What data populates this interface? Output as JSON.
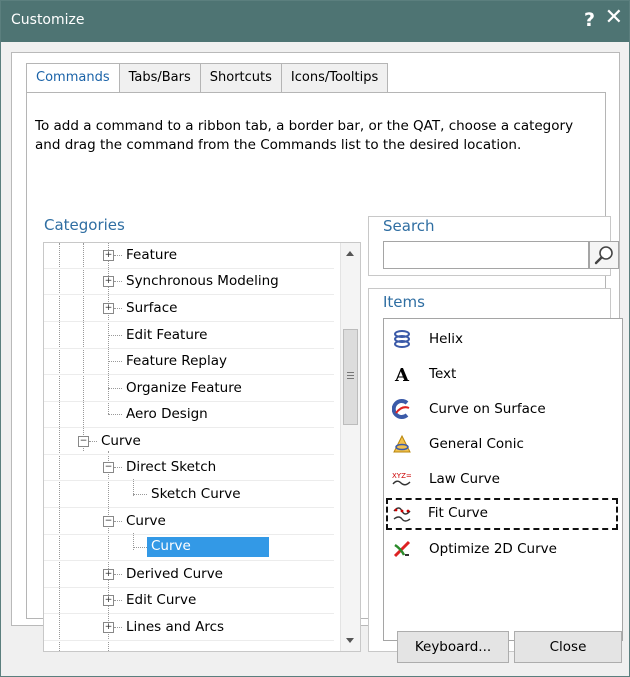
{
  "window": {
    "title": "Customize",
    "help_glyph": "?",
    "close_glyph": "✕"
  },
  "tabs": [
    {
      "label": "Commands",
      "active": true
    },
    {
      "label": "Tabs/Bars"
    },
    {
      "label": "Shortcuts"
    },
    {
      "label": "Icons/Tooltips"
    }
  ],
  "instructions": "To add a command to a ribbon tab, a border bar, or the QAT, choose a category and drag the command from the Commands list to the desired location.",
  "categories": {
    "title": "Categories",
    "items": [
      {
        "label": "Feature",
        "expander": "+"
      },
      {
        "label": "Synchronous Modeling",
        "expander": "+"
      },
      {
        "label": "Surface",
        "expander": "+"
      },
      {
        "label": "Edit Feature"
      },
      {
        "label": "Feature Replay"
      },
      {
        "label": "Organize Feature"
      },
      {
        "label": "Aero Design"
      },
      {
        "label": "Curve",
        "expander": "−"
      },
      {
        "label": "Direct Sketch",
        "expander": "−"
      },
      {
        "label": "Sketch Curve"
      },
      {
        "label": "Curve",
        "expander": "−"
      },
      {
        "label": "Curve",
        "selected": true
      },
      {
        "label": "Derived Curve",
        "expander": "+"
      },
      {
        "label": "Edit Curve",
        "expander": "+"
      },
      {
        "label": "Lines and Arcs",
        "expander": "+"
      }
    ]
  },
  "search": {
    "title": "Search",
    "value": "",
    "icon": "magnifier-icon"
  },
  "items": {
    "title": "Items",
    "list": [
      {
        "label": "Helix",
        "icon": "helix-icon"
      },
      {
        "label": "Text",
        "icon": "text-icon"
      },
      {
        "label": "Curve on Surface",
        "icon": "curve-on-surface-icon"
      },
      {
        "label": "General Conic",
        "icon": "general-conic-icon"
      },
      {
        "label": "Law Curve",
        "icon": "law-curve-icon"
      },
      {
        "label": "Fit Curve",
        "icon": "fit-curve-icon",
        "focused": true
      },
      {
        "label": "Optimize 2D Curve",
        "icon": "optimize-2d-curve-icon"
      }
    ]
  },
  "buttons": {
    "keyboard": "Keyboard...",
    "close": "Close"
  },
  "colors": {
    "titlebar": "#4e7473",
    "accent": "#2f6ea2",
    "selection": "#3399e6"
  }
}
